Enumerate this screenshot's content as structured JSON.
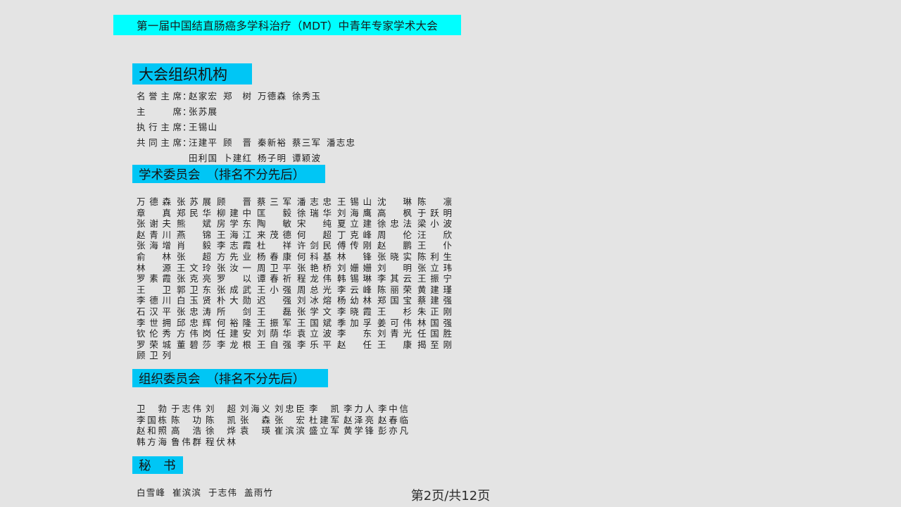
{
  "slide": {
    "title": "第一届中国结直肠癌多学科治疗（MDT）中青年专家学术大会",
    "background_color": "#e4e4e4",
    "title_banner_color": "#00ffff",
    "section_header_color": "#00c6f5",
    "text_color": "#1e1e1e"
  },
  "sections": {
    "organization": {
      "header": "大会组织机构",
      "roles": [
        {
          "label": "名誉主席",
          "colon": "：",
          "names": [
            "赵家宏",
            "郑树",
            "万德森",
            "徐秀玉"
          ]
        },
        {
          "label": "主席",
          "colon": "：",
          "names": [
            "张苏展"
          ]
        },
        {
          "label": "执行主席",
          "colon": "：",
          "names": [
            "王锡山"
          ]
        },
        {
          "label": "共同主席",
          "colon": "：",
          "names": [
            "汪建平",
            "顾晋",
            "秦新裕",
            "蔡三军",
            "潘志忠"
          ]
        },
        {
          "label": "",
          "colon": "",
          "names": [
            "田利国",
            "卜建红",
            "杨子明",
            "谭颖波"
          ]
        }
      ]
    },
    "academic_committee": {
      "header": "学术委员会　（排名不分先后）",
      "columns": 8,
      "members": [
        "万德森",
        "张苏展",
        "顾晋",
        "蔡三军",
        "潘志忠",
        "王锡山",
        "沈琳",
        "陈凛",
        "章真",
        "郑民华",
        "柳建中",
        "匡毅",
        "徐瑞华",
        "刘海鹰",
        "高枫",
        "于跃明",
        "张谢夫",
        "熊斌",
        "房学东",
        "陶敏",
        "宋纯",
        "夏立建",
        "徐忠法",
        "梁小波",
        "赵青川",
        "燕锦",
        "王海江",
        "来茂德",
        "何超",
        "丁克峰",
        "周伦",
        "汪欣",
        "张海增",
        "肖毅",
        "李志霞",
        "杜祥",
        "许剑民",
        "傅传刚",
        "赵鹏",
        "王仆",
        "俞林",
        "张超",
        "方先业",
        "杨春康",
        "何科基",
        "林锋",
        "张晓实",
        "陈利生",
        "林源",
        "王文玲",
        "张汝一",
        "周卫平",
        "张艳桥",
        "刘姗姗",
        "刘明",
        "张立玮",
        "罗素霞",
        "张克亮",
        "罗以",
        "谭春祈",
        "程龙伟",
        "韩锡琳",
        "李其云",
        "王振宁",
        "王卫",
        "郭卫东",
        "张成武",
        "王小强",
        "周总光",
        "李云峰",
        "陈丽荣",
        "黄建瑾",
        "李德川",
        "白玉贤",
        "朴大勋",
        "迟强",
        "刘冰熔",
        "杨幼林",
        "郑国宝",
        "蔡建强",
        "石汉平",
        "张忠涛",
        "所剑",
        "王磊",
        "张学文",
        "李晓霞",
        "王杉",
        "朱正刚",
        "李世拥",
        "邱忠辉",
        "何裕隆",
        "王振军",
        "王国斌",
        "季加孚",
        "姜可伟",
        "林国强",
        "钦伦秀",
        "方伟岗",
        "任建安",
        "刘荫华",
        "袁立波",
        "李东",
        "刘青光",
        "任国胜",
        "罗荣城",
        "董碧莎",
        "李龙根",
        "王自强",
        "李乐平",
        "赵任",
        "王康",
        "揭至刚",
        "顾卫列"
      ]
    },
    "organizing_committee": {
      "header": "组织委员会　（排名不分先后）",
      "columns": 8,
      "members": [
        "卫勃",
        "于志伟",
        "刘超",
        "刘海义",
        "刘忠臣",
        "李凯",
        "李力人",
        "李中信",
        "李国栋",
        "陈功",
        "陈凯",
        "张森",
        "张宏",
        "杜建军",
        "赵泽亮",
        "赵春临",
        "赵和照",
        "高浩",
        "徐烨",
        "袁瑛",
        "崔滨滨",
        "盛立军",
        "黄学锋",
        "彭亦凡",
        "韩方海",
        "鲁伟群",
        "程伏林"
      ]
    },
    "secretary": {
      "header": "秘　书",
      "members": [
        "白雪峰",
        "崔滨滨",
        "于志伟",
        "盖雨竹"
      ]
    }
  },
  "footer": {
    "page_indicator": "第2页/共12页"
  }
}
